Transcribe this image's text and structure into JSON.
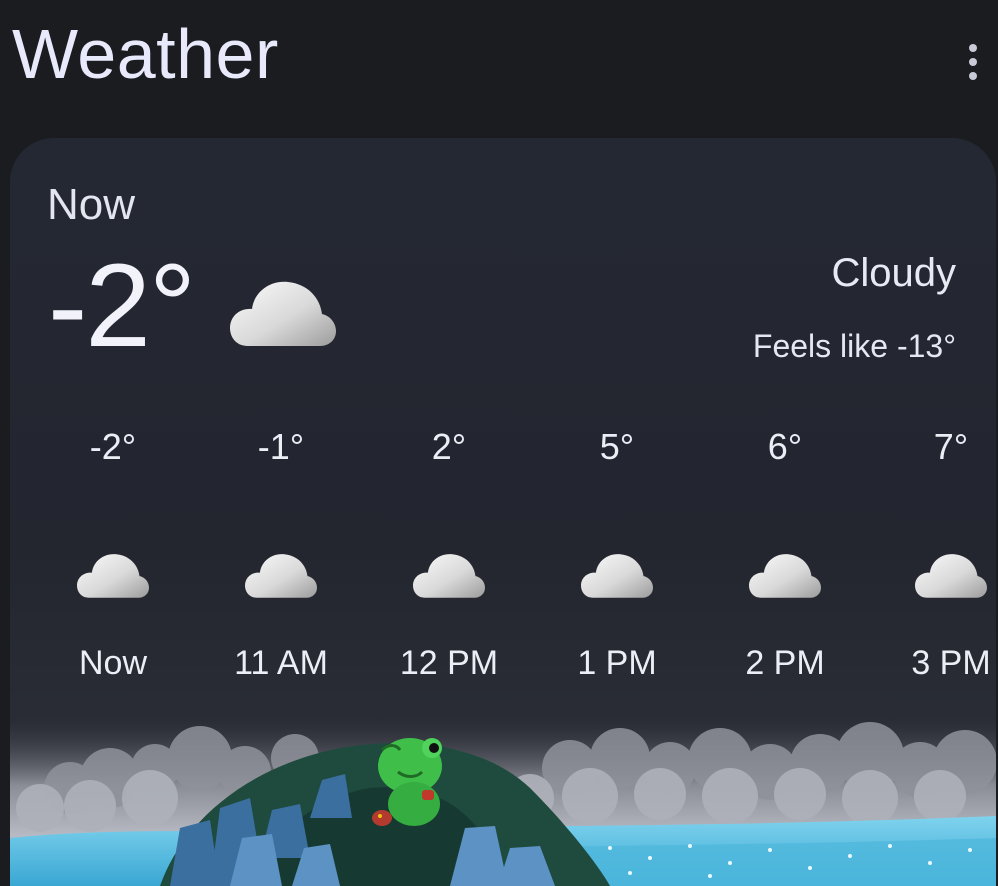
{
  "app": {
    "title": "Weather"
  },
  "icons": {
    "menu": "more-vert-icon",
    "condition": "cloud-icon"
  },
  "current": {
    "label": "Now",
    "temperature": "-2°",
    "condition": "Cloudy",
    "feels_like": "Feels like -13°"
  },
  "hourly": [
    {
      "temp": "-2°",
      "time": "Now",
      "icon": "cloud-icon"
    },
    {
      "temp": "-1°",
      "time": "11 AM",
      "icon": "cloud-icon"
    },
    {
      "temp": "2°",
      "time": "12 PM",
      "icon": "cloud-icon"
    },
    {
      "temp": "5°",
      "time": "1 PM",
      "icon": "cloud-icon"
    },
    {
      "temp": "6°",
      "time": "2 PM",
      "icon": "cloud-icon"
    },
    {
      "temp": "7°",
      "time": "3 PM",
      "icon": "cloud-icon"
    }
  ],
  "colors": {
    "background": "#1a1c20",
    "card": "#242833",
    "text": "#eef0fa",
    "frog": "#3fbf4a",
    "water": "#5fc6e6"
  }
}
